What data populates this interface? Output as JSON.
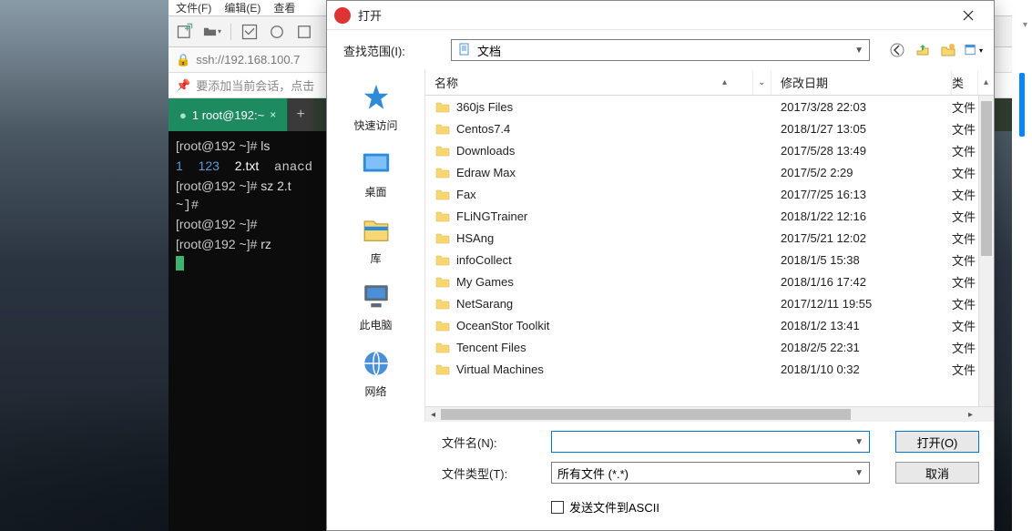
{
  "menu": {
    "file": "文件(F)",
    "edit": "编辑(E)",
    "view": "查看"
  },
  "ssh_addr": "ssh://192.168.100.7",
  "info_hint": "要添加当前会话，点击",
  "tab": {
    "label": "1 root@192:~",
    "close": "×"
  },
  "terminal_lines": [
    {
      "prompt": "[root@192 ~]# ",
      "cmd": "ls"
    },
    {
      "plain": "1  123  2.txt  anacd"
    },
    {
      "prompt": "[root@192 ~]# ",
      "cmd": "sz 2.t"
    },
    {
      "plain": "~]#"
    },
    {
      "prompt": "[root@192 ~]# ",
      "cmd": ""
    },
    {
      "prompt": "[root@192 ~]# ",
      "cmd": "rz"
    }
  ],
  "dialog": {
    "title": "打开",
    "lookin_label": "查找范围(I):",
    "lookin_value": "文档",
    "sidebar": [
      {
        "label": "快速访问",
        "icon": "star"
      },
      {
        "label": "桌面",
        "icon": "desktop"
      },
      {
        "label": "库",
        "icon": "library"
      },
      {
        "label": "此电脑",
        "icon": "pc"
      },
      {
        "label": "网络",
        "icon": "network"
      }
    ],
    "columns": {
      "name": "名称",
      "date": "修改日期",
      "type": "类"
    },
    "files": [
      {
        "name": "360js Files",
        "date": "2017/3/28 22:03",
        "type": "文件"
      },
      {
        "name": "Centos7.4",
        "date": "2018/1/27 13:05",
        "type": "文件"
      },
      {
        "name": "Downloads",
        "date": "2017/5/28 13:49",
        "type": "文件"
      },
      {
        "name": "Edraw Max",
        "date": "2017/5/2 2:29",
        "type": "文件"
      },
      {
        "name": "Fax",
        "date": "2017/7/25 16:13",
        "type": "文件"
      },
      {
        "name": "FLiNGTrainer",
        "date": "2018/1/22 12:16",
        "type": "文件"
      },
      {
        "name": "HSAng",
        "date": "2017/5/21 12:02",
        "type": "文件"
      },
      {
        "name": "infoCollect",
        "date": "2018/1/5 15:38",
        "type": "文件"
      },
      {
        "name": "My Games",
        "date": "2018/1/16 17:42",
        "type": "文件"
      },
      {
        "name": "NetSarang",
        "date": "2017/12/11 19:55",
        "type": "文件"
      },
      {
        "name": "OceanStor Toolkit",
        "date": "2018/1/2 13:41",
        "type": "文件"
      },
      {
        "name": "Tencent Files",
        "date": "2018/2/5 22:31",
        "type": "文件"
      },
      {
        "name": "Virtual Machines",
        "date": "2018/1/10 0:32",
        "type": "文件"
      }
    ],
    "filename_label": "文件名(N):",
    "filename_value": "",
    "filetype_label": "文件类型(T):",
    "filetype_value": "所有文件 (*.*)",
    "open_btn": "打开(O)",
    "cancel_btn": "取消",
    "ascii_check": "发送文件到ASCII"
  }
}
